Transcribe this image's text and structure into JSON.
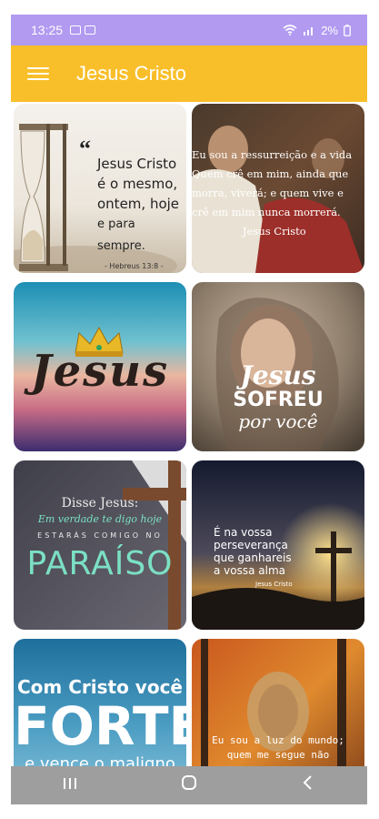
{
  "status": {
    "time": "13:25",
    "battery": "2%"
  },
  "appbar": {
    "title": "Jesus Cristo"
  },
  "tiles": [
    {
      "quote_lines": [
        "Jesus Cristo",
        "é o mesmo,",
        "ontem, hoje",
        "e para sempre."
      ],
      "reference": "- Hebreus 13:8 -"
    },
    {
      "lines": [
        "Eu sou a ressurreição e a vida",
        "Quem crê em mim, ainda que",
        "morra, viverá; e quem vive e",
        "crê em mim nunca morrerá."
      ],
      "signature": "Jesus Cristo"
    },
    {
      "word": "Jesus"
    },
    {
      "line1": "Jesus",
      "line2": "SOFREU",
      "line3": "por você"
    },
    {
      "line1": "Disse Jesus:",
      "line2": "Em verdade te digo hoje",
      "line3": "ESTARÁS COMIGO NO",
      "line4": "PARAÍSO"
    },
    {
      "lines": [
        "É na vossa",
        "perseverança",
        "que ganhareis",
        "a vossa alma"
      ],
      "signature": "Jesus Cristo"
    },
    {
      "line1": "Com Cristo você",
      "line2": "FORTE",
      "line3": "e vence o maligno"
    },
    {
      "line1": "Eu sou a luz do mundo;",
      "line2": "quem me segue não"
    }
  ],
  "colors": {
    "status_bar": "#b19af0",
    "app_bar": "#f9bf2a",
    "nav_bar": "#9e9e9e"
  },
  "navbar": {
    "recents": "recents-icon",
    "home": "home-icon",
    "back": "back-icon"
  }
}
